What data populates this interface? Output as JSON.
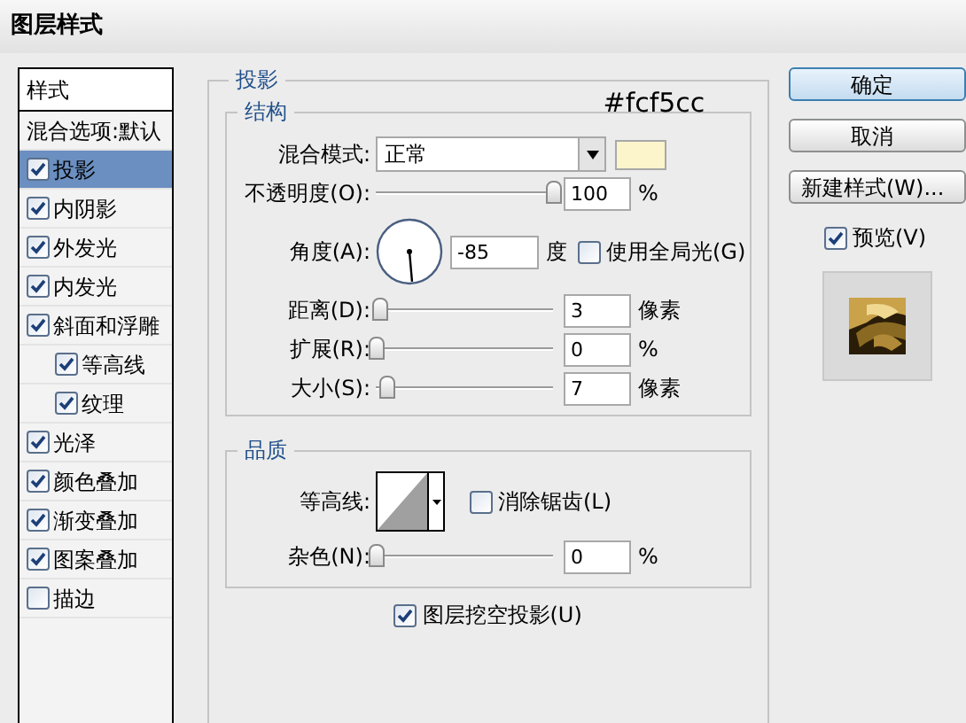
{
  "window": {
    "title": "图层样式"
  },
  "styles_list": {
    "header": "样式",
    "items": [
      {
        "label": "混合选项:默认",
        "kind": "plain",
        "selected": false
      },
      {
        "label": "投影",
        "kind": "check",
        "checked": true,
        "selected": true
      },
      {
        "label": "内阴影",
        "kind": "check",
        "checked": true,
        "selected": false
      },
      {
        "label": "外发光",
        "kind": "check",
        "checked": true,
        "selected": false
      },
      {
        "label": "内发光",
        "kind": "check",
        "checked": true,
        "selected": false
      },
      {
        "label": "斜面和浮雕",
        "kind": "check",
        "checked": true,
        "selected": false,
        "children": [
          {
            "label": "等高线",
            "kind": "check",
            "checked": true,
            "selected": false
          },
          {
            "label": "纹理",
            "kind": "check",
            "checked": true,
            "selected": false
          }
        ]
      },
      {
        "label": "光泽",
        "kind": "check",
        "checked": true,
        "selected": false
      },
      {
        "label": "颜色叠加",
        "kind": "check",
        "checked": true,
        "selected": false
      },
      {
        "label": "渐变叠加",
        "kind": "check",
        "checked": true,
        "selected": false
      },
      {
        "label": "图案叠加",
        "kind": "check",
        "checked": true,
        "selected": false
      },
      {
        "label": "描边",
        "kind": "check",
        "checked": false,
        "selected": false
      }
    ]
  },
  "drop_shadow": {
    "title": "投影",
    "structure": {
      "title": "结构",
      "color_note": "#fcf5cc",
      "blend_mode": {
        "label": "混合模式:",
        "value": "正常"
      },
      "opacity": {
        "label": "不透明度(O):",
        "level": 1,
        "value": "100",
        "unit": "%"
      },
      "angle": {
        "label": "角度(A):",
        "value": "-85",
        "unit": "度",
        "global_light": {
          "label": "使用全局光(G)",
          "checked": false
        }
      },
      "sliders": [
        {
          "label": "距离(D):",
          "level": 0.02,
          "value": "3",
          "unit": "像素"
        },
        {
          "label": "扩展(R):",
          "level": 0,
          "value": "0",
          "unit": "%"
        },
        {
          "label": "大小(S):",
          "level": 0.06,
          "value": "7",
          "unit": "像素"
        }
      ]
    },
    "quality": {
      "title": "品质",
      "contour": {
        "label": "等高线:"
      },
      "anti_alias": {
        "label": "消除锯齿(L)",
        "checked": false
      },
      "noise": {
        "label": "杂色(N):",
        "level": 0,
        "value": "0",
        "unit": "%"
      }
    },
    "knockout": {
      "label": "图层挖空投影(U)",
      "checked": true
    }
  },
  "buttons": [
    {
      "label": "确定",
      "kind": "default"
    },
    {
      "label": "取消",
      "kind": "normal"
    },
    {
      "label": "新建样式(W)...",
      "kind": "normal"
    }
  ],
  "preview": {
    "label": "预览(V)",
    "checked": true
  }
}
